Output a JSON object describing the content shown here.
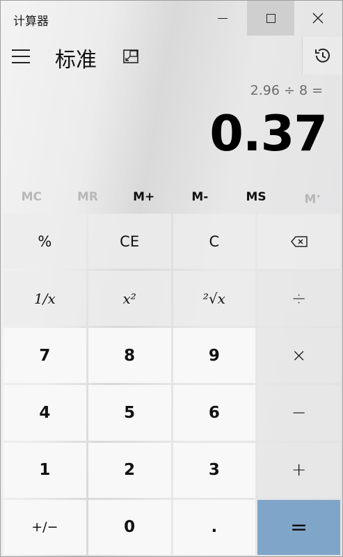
{
  "window": {
    "title": "计算器"
  },
  "header": {
    "mode": "标准",
    "history_icon": "history-icon",
    "keep_on_top_icon": "keep-on-top-icon"
  },
  "display": {
    "expression": "2.96 ÷ 8 =",
    "result": "0.37"
  },
  "memory": [
    {
      "label": "MC",
      "enabled": false
    },
    {
      "label": "MR",
      "enabled": false
    },
    {
      "label": "M+",
      "enabled": true
    },
    {
      "label": "M-",
      "enabled": true
    },
    {
      "label": "MS",
      "enabled": true
    },
    {
      "label": "M",
      "enabled": false
    }
  ],
  "keys": {
    "percent": "%",
    "ce": "CE",
    "c": "C",
    "reciprocal": "1/x",
    "square": "x²",
    "sqrt": "²√x",
    "divide": "÷",
    "seven": "7",
    "eight": "8",
    "nine": "9",
    "multiply": "×",
    "four": "4",
    "five": "5",
    "six": "6",
    "minus": "−",
    "one": "1",
    "two": "2",
    "three": "3",
    "plus": "+",
    "negate": "+/−",
    "zero": "0",
    "decimal": ".",
    "equals": "="
  },
  "colors": {
    "equals_bg": "#7fa6c9",
    "window_bg": "#e6e6e6"
  }
}
